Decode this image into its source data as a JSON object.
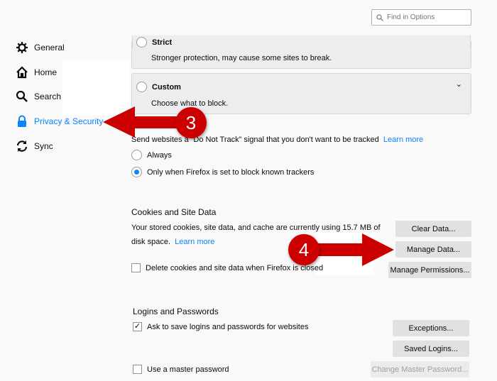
{
  "search": {
    "placeholder": "Find in Options",
    "icon": "search-icon"
  },
  "sidebar": {
    "items": [
      {
        "label": "General",
        "icon": "gear-icon"
      },
      {
        "label": "Home",
        "icon": "home-icon"
      },
      {
        "label": "Search",
        "icon": "search-icon"
      },
      {
        "label": "Privacy & Security",
        "icon": "lock-icon",
        "active": true
      },
      {
        "label": "Sync",
        "icon": "sync-icon"
      }
    ]
  },
  "blocking": {
    "strict": {
      "title": "Strict",
      "desc": "Stronger protection, may cause some sites to break."
    },
    "custom": {
      "title": "Custom",
      "desc": "Choose what to block."
    }
  },
  "dnt": {
    "text": "Send websites a “Do Not Track” signal that you don't want to be tracked",
    "learn_more": "Learn more",
    "options": [
      "Always",
      "Only when Firefox is set to block known trackers"
    ],
    "selected": 1
  },
  "cookies": {
    "title": "Cookies and Site Data",
    "desc1": "Your stored cookies, site data, and cache are currently using 15.7 MB of",
    "desc2": "disk space.",
    "learn_more": "Learn more",
    "delete_label": "Delete cookies and site data when Firefox is closed",
    "delete_checked": false,
    "buttons": {
      "clear": "Clear Data...",
      "manage": "Manage Data...",
      "permissions": "Manage Permissions..."
    }
  },
  "logins": {
    "title": "Logins and Passwords",
    "ask_label": "Ask to save logins and passwords for websites",
    "ask_checked": true,
    "master_label": "Use a master password",
    "master_checked": false,
    "buttons": {
      "exceptions": "Exceptions...",
      "saved": "Saved Logins...",
      "change_master": "Change Master Password..."
    }
  },
  "annotations": {
    "step3": "3",
    "step4": "4",
    "color": "#cc0000"
  }
}
